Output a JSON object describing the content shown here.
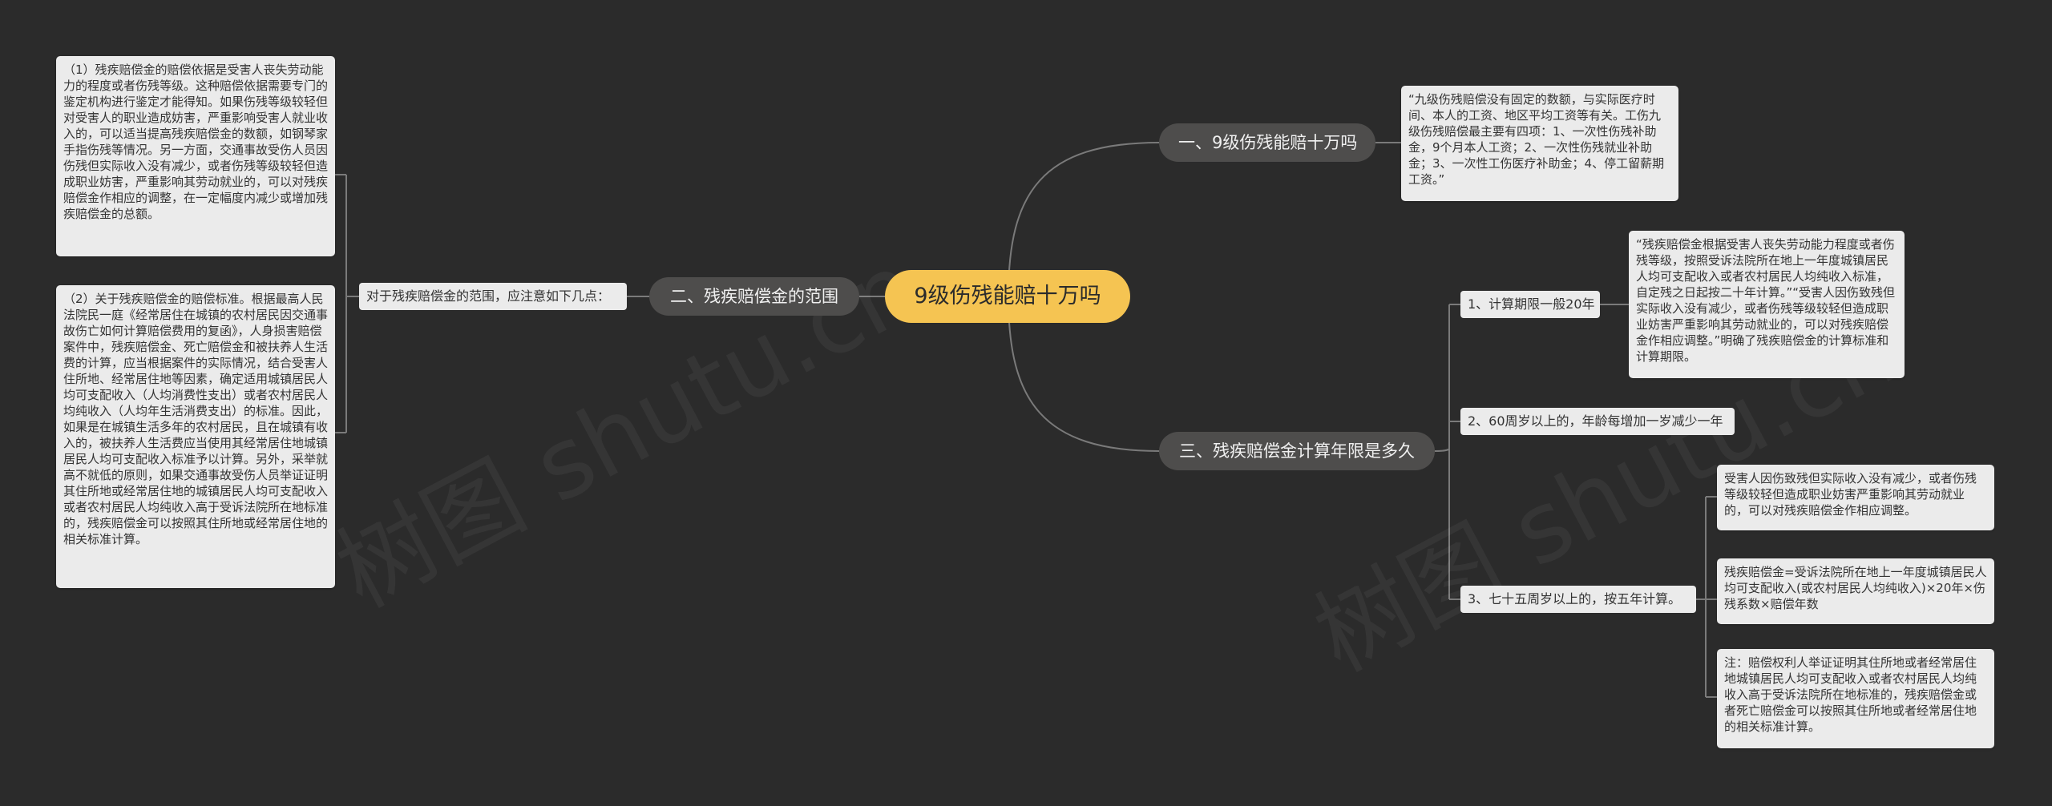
{
  "root": {
    "text": "9级伤残能赔十万吗"
  },
  "branches": {
    "b1": {
      "text": "一、9级伤残能赔十万吗",
      "leaf": "“九级伤残赔偿没有固定的数额，与实际医疗时间、本人的工资、地区平均工资等有关。工伤九级伤残赔偿最主要有四项：1、一次性伤残补助金，9个月本人工资；2、一次性伤残就业补助金；3、一次性工伤医疗补助金；4、停工留薪期工资。”"
    },
    "b2": {
      "text": "二、残疾赔偿金的范围",
      "label": "对于残疾赔偿金的范围，应注意如下几点：",
      "leaves": [
        "（1）残疾赔偿金的赔偿依据是受害人丧失劳动能力的程度或者伤残等级。这种赔偿依据需要专门的鉴定机构进行鉴定才能得知。如果伤残等级较轻但对受害人的职业造成妨害，严重影响受害人就业收入的，可以适当提高残疾赔偿金的数额，如钢琴家手指伤残等情况。另一方面，交通事故受伤人员因伤残但实际收入没有减少，或者伤残等级较轻但造成职业妨害，严重影响其劳动就业的，可以对残疾赔偿金作相应的调整，在一定幅度内减少或增加残疾赔偿金的总额。",
        "（2）关于残疾赔偿金的赔偿标准。根据最高人民法院民一庭《经常居住在城镇的农村居民因交通事故伤亡如何计算赔偿费用的复函》，人身损害赔偿案件中，残疾赔偿金、死亡赔偿金和被扶养人生活费的计算，应当根据案件的实际情况，结合受害人住所地、经常居住地等因素，确定适用城镇居民人均可支配收入（人均消费性支出）或者农村居民人均纯收入（人均年生活消费支出）的标准。因此，如果是在城镇生活多年的农村居民，且在城镇有收入的，被扶养人生活费应当使用其经常居住地城镇居民人均可支配收入标准予以计算。另外，采举就高不就低的原则，如果交通事故受伤人员举证证明其住所地或经常居住地的城镇居民人均可支配收入或者农村居民人均纯收入高于受诉法院所在地标准的，残疾赔偿金可以按照其住所地或经常居住地的相关标准计算。"
      ]
    },
    "b3": {
      "text": "三、残疾赔偿金计算年限是多久",
      "subs": [
        {
          "label": "1、计算期限一般20年",
          "leaf": "“残疾赔偿金根据受害人丧失劳动能力程度或者伤残等级，按照受诉法院所在地上一年度城镇居民人均可支配收入或者农村居民人均纯收入标准，自定残之日起按二十年计算。”“受害人因伤致残但实际收入没有减少，或者伤残等级较轻但造成职业妨害严重影响其劳动就业的，可以对残疾赔偿金作相应调整。”明确了残疾赔偿金的计算标准和计算期限。"
        },
        {
          "label": "2、60周岁以上的，年龄每增加一岁减少一年"
        },
        {
          "label": "3、七十五周岁以上的，按五年计算。",
          "leaves": [
            "受害人因伤致残但实际收入没有减少，或者伤残等级较轻但造成职业妨害严重影响其劳动就业的，可以对残疾赔偿金作相应调整。",
            "残疾赔偿金=受诉法院所在地上一年度城镇居民人均可支配收入(或农村居民人均纯收入)×20年×伤残系数×赔偿年数",
            "注：赔偿权利人举证证明其住所地或者经常居住地城镇居民人均可支配收入或者农村居民人均纯收入高于受诉法院所在地标准的，残疾赔偿金或者死亡赔偿金可以按照其住所地或者经常居住地的相关标准计算。"
          ]
        }
      ]
    }
  },
  "colors": {
    "background": "#2b2b2b",
    "root": "#f5c452",
    "branch": "#4e4d4c",
    "leaf": "#ebebeb",
    "link": "#7a7a7a"
  }
}
